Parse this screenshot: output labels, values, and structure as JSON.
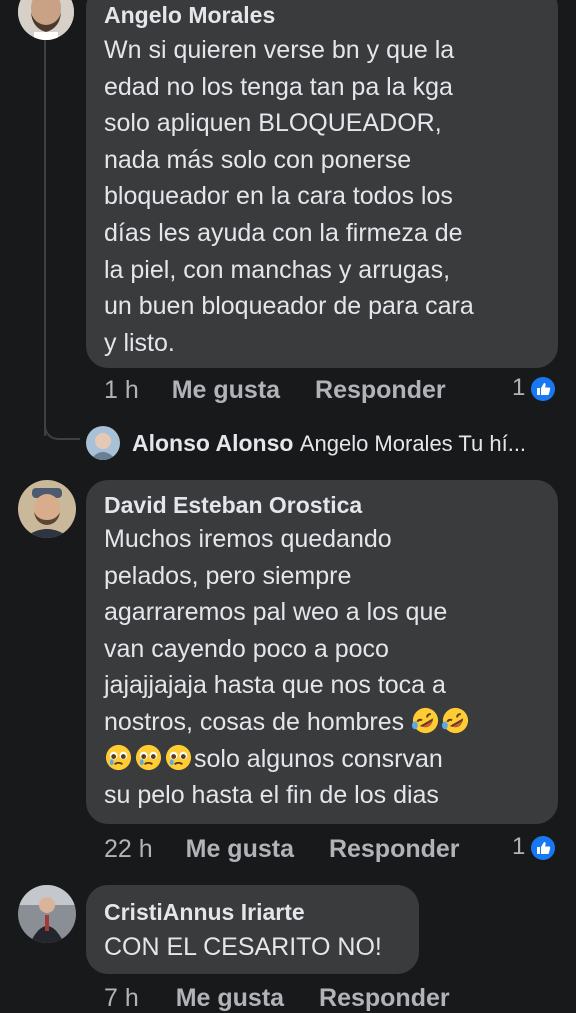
{
  "comments": [
    {
      "author": "Angelo Morales",
      "text": "Wn si quieren verse bn y que la\nedad no los tenga tan pa la kga\nsolo apliquen BLOQUEADOR,\nnada más solo con ponerse\nbloqueador en la cara todos los\ndías les ayuda con la firmeza de\nla piel, con manchas y arrugas,\nun buen bloqueador de para cara\ny listo.",
      "time": "1 h",
      "like_label": "Me gusta",
      "reply_label": "Responder",
      "reaction_count": "1"
    },
    {
      "reply_preview": {
        "author": "Alonso Alonso",
        "text": "Angelo Morales Tu hí..."
      }
    },
    {
      "author": "David Esteban Orostica",
      "text_lines": [
        "Muchos iremos quedando",
        "pelados, pero siempre",
        "agarraremos pal weo a los que",
        "van cayendo poco a poco",
        "jajajjajaja hasta que nos toca a",
        "nostros, cosas de hombres ",
        "solo algunos consrvan",
        "su pelo hasta el fin de los dias"
      ],
      "time": "22 h",
      "like_label": "Me gusta",
      "reply_label": "Responder",
      "reaction_count": "1"
    },
    {
      "author": "CristiAnnus Iriarte",
      "text": "CON EL CESARITO NO!",
      "time": "7 h",
      "like_label": "Me gusta",
      "reply_label": "Responder"
    }
  ],
  "icons": {
    "like": "thumbs-up-icon",
    "rofl": "rolling-on-floor-laughing-emoji",
    "pleading": "pleading-face-emoji"
  },
  "colors": {
    "background": "#18191a",
    "bubble": "#3a3b3c",
    "text": "#e4e6eb",
    "secondary": "#b0b3b8",
    "like_blue": "#1877f2"
  }
}
